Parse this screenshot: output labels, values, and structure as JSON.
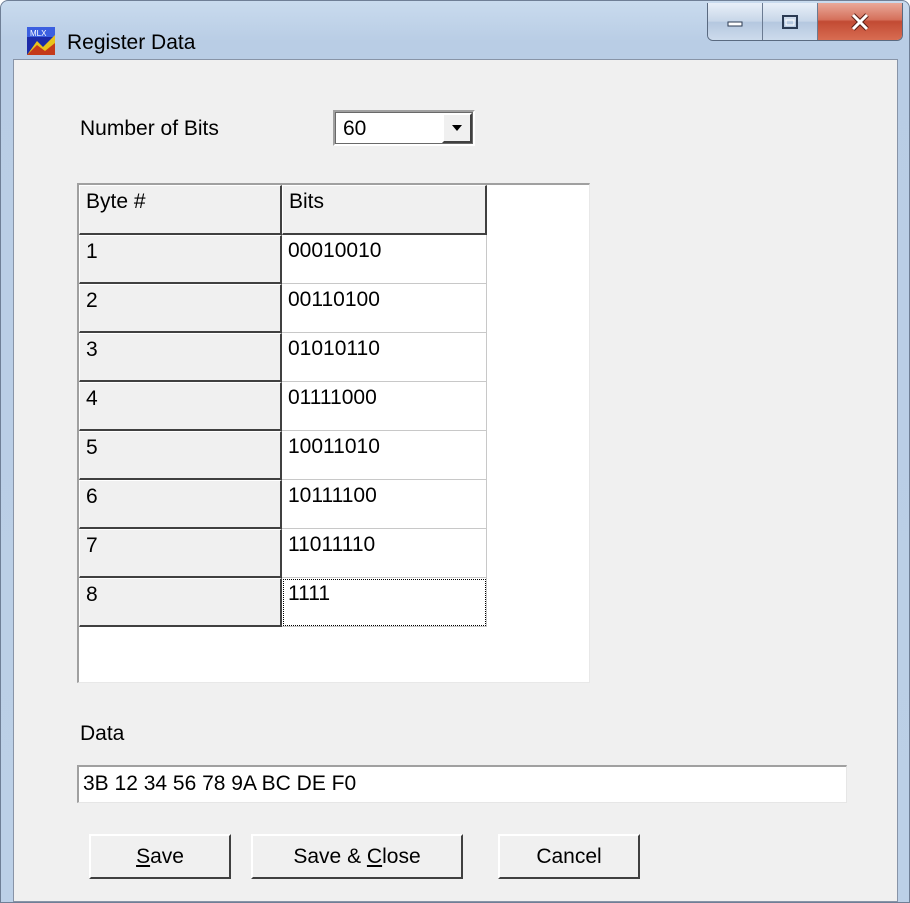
{
  "window": {
    "title": "Register Data",
    "controls": [
      "minimize",
      "maximize",
      "close"
    ]
  },
  "number_of_bits": {
    "label": "Number of Bits",
    "selected": "60"
  },
  "grid": {
    "columns": [
      "Byte #",
      "Bits"
    ],
    "rows": [
      {
        "byte": "1",
        "bits": "00010010"
      },
      {
        "byte": "2",
        "bits": "00110100"
      },
      {
        "byte": "3",
        "bits": "01010110"
      },
      {
        "byte": "4",
        "bits": "01111000"
      },
      {
        "byte": "5",
        "bits": "10011010"
      },
      {
        "byte": "6",
        "bits": "10111100"
      },
      {
        "byte": "7",
        "bits": "11011110"
      },
      {
        "byte": "8",
        "bits": "1111"
      }
    ]
  },
  "data": {
    "label": "Data",
    "value": "3B 12 34 56 78 9A BC DE F0"
  },
  "buttons": {
    "save": {
      "mnemonic": "S",
      "rest": "ave"
    },
    "save_close": {
      "before": "Save & ",
      "mnemonic": "C",
      "rest": "lose"
    },
    "cancel": "Cancel"
  }
}
